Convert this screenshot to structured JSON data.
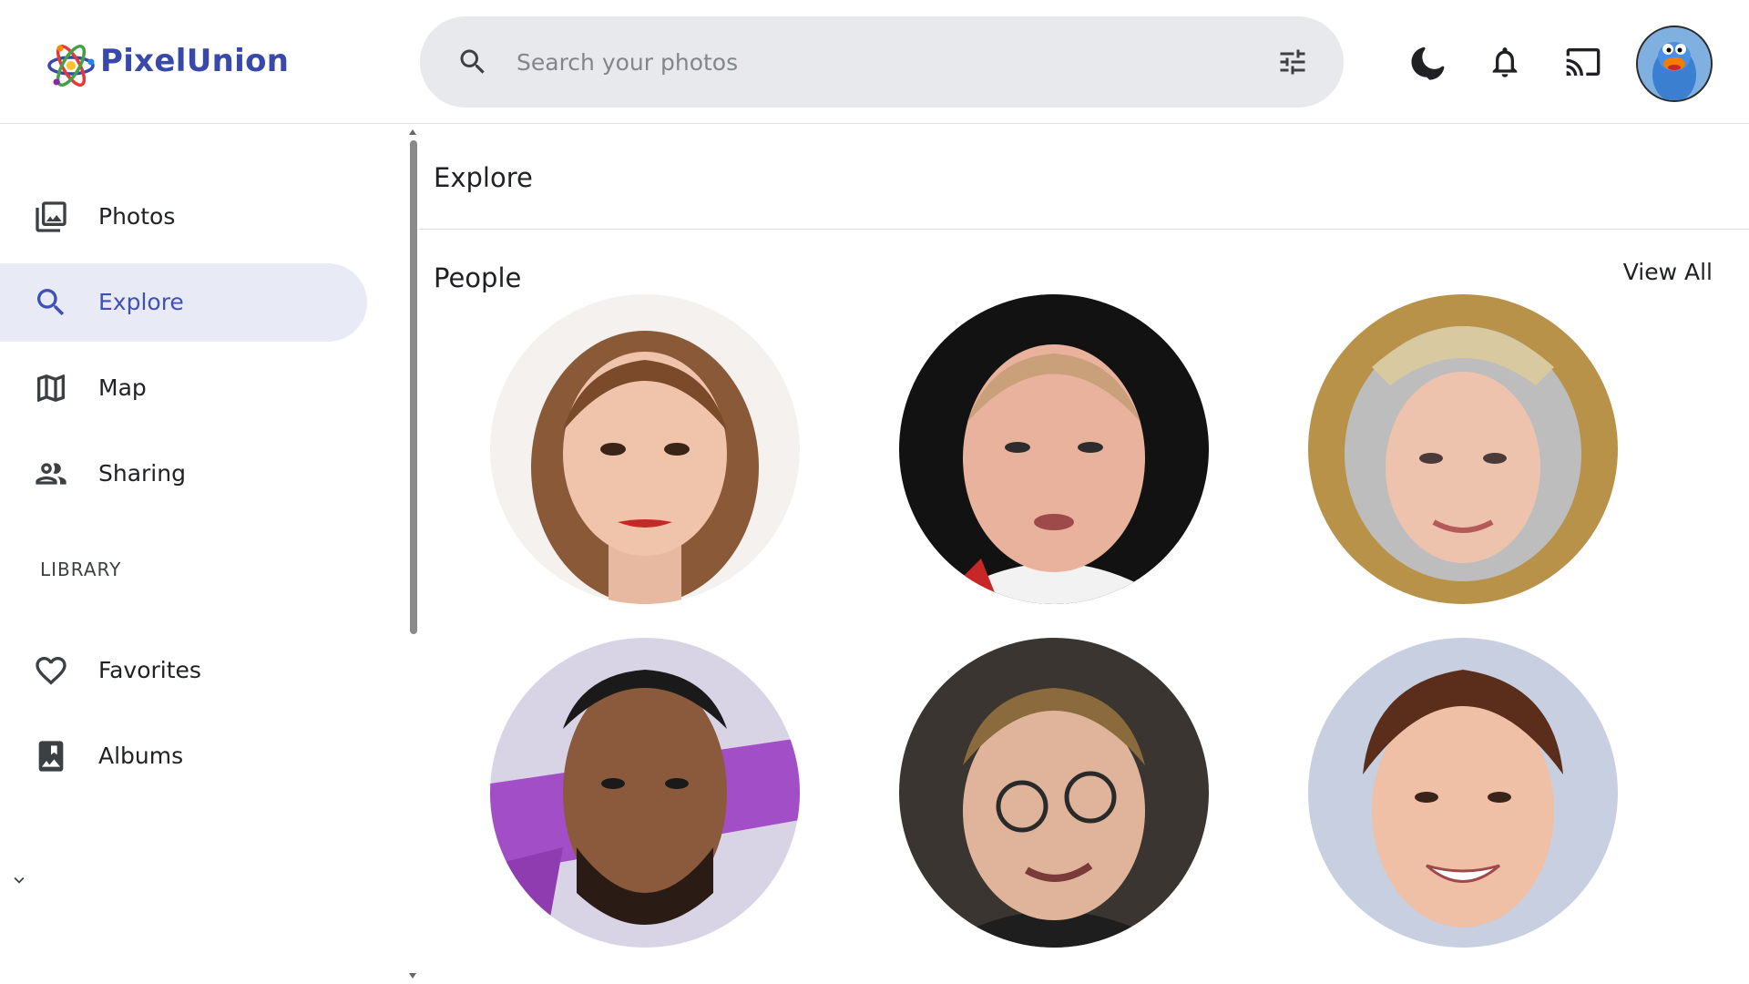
{
  "app": {
    "name": "PixelUnion"
  },
  "search": {
    "placeholder": "Search your photos"
  },
  "header": {
    "icons": [
      "search-icon",
      "tune-icon",
      "moon-icon",
      "bell-icon",
      "cast-icon"
    ],
    "avatar": "avatar"
  },
  "sidebar": {
    "items": [
      {
        "label": "Photos",
        "icon": "photos-icon",
        "active": false
      },
      {
        "label": "Explore",
        "icon": "search-icon",
        "active": true
      },
      {
        "label": "Map",
        "icon": "map-icon",
        "active": false
      },
      {
        "label": "Sharing",
        "icon": "people-icon",
        "active": false
      }
    ],
    "library_label": "LIBRARY",
    "library_items": [
      {
        "label": "Favorites",
        "icon": "heart-icon"
      },
      {
        "label": "Albums",
        "icon": "album-icon",
        "expandable": true
      }
    ]
  },
  "main": {
    "title": "Explore",
    "people": {
      "title": "People",
      "view_all": "View All",
      "count": 6
    }
  },
  "colors": {
    "brand": "#3949ab",
    "active_nav_bg": "#e8eaf6",
    "active_nav_text": "#3f51b5",
    "search_bg": "#e8e9ed"
  }
}
